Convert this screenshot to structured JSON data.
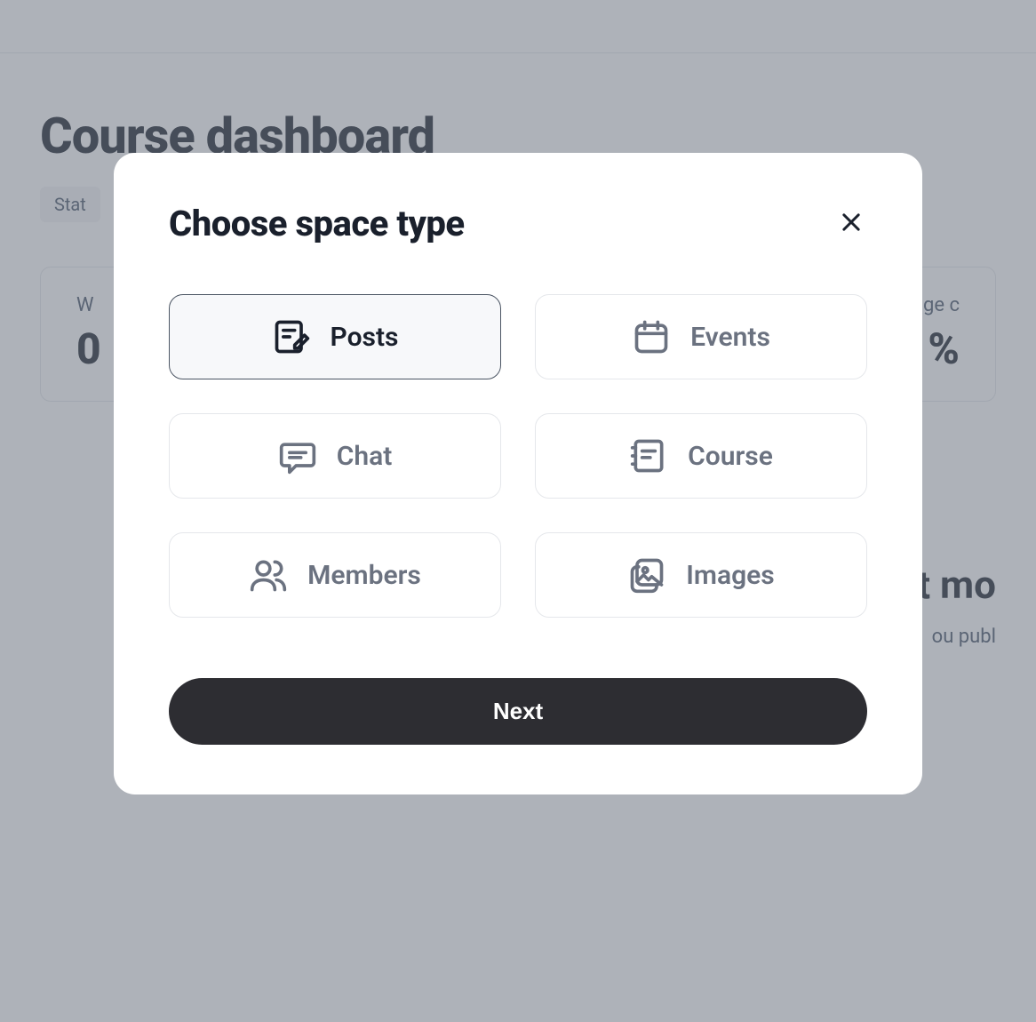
{
  "background": {
    "page_title": "Course dashboard",
    "status_label": "Stat",
    "stat_card_label": "W",
    "stat_card_value": "0",
    "stat_card2_label": "erage c",
    "stat_card2_value": "%",
    "draft_title": "ft mo",
    "draft_text": "ou publ"
  },
  "modal": {
    "title": "Choose space type",
    "next_button_label": "Next",
    "options": [
      {
        "id": "posts",
        "label": "Posts",
        "selected": true
      },
      {
        "id": "events",
        "label": "Events",
        "selected": false
      },
      {
        "id": "chat",
        "label": "Chat",
        "selected": false
      },
      {
        "id": "course",
        "label": "Course",
        "selected": false
      },
      {
        "id": "members",
        "label": "Members",
        "selected": false
      },
      {
        "id": "images",
        "label": "Images",
        "selected": false
      }
    ]
  }
}
